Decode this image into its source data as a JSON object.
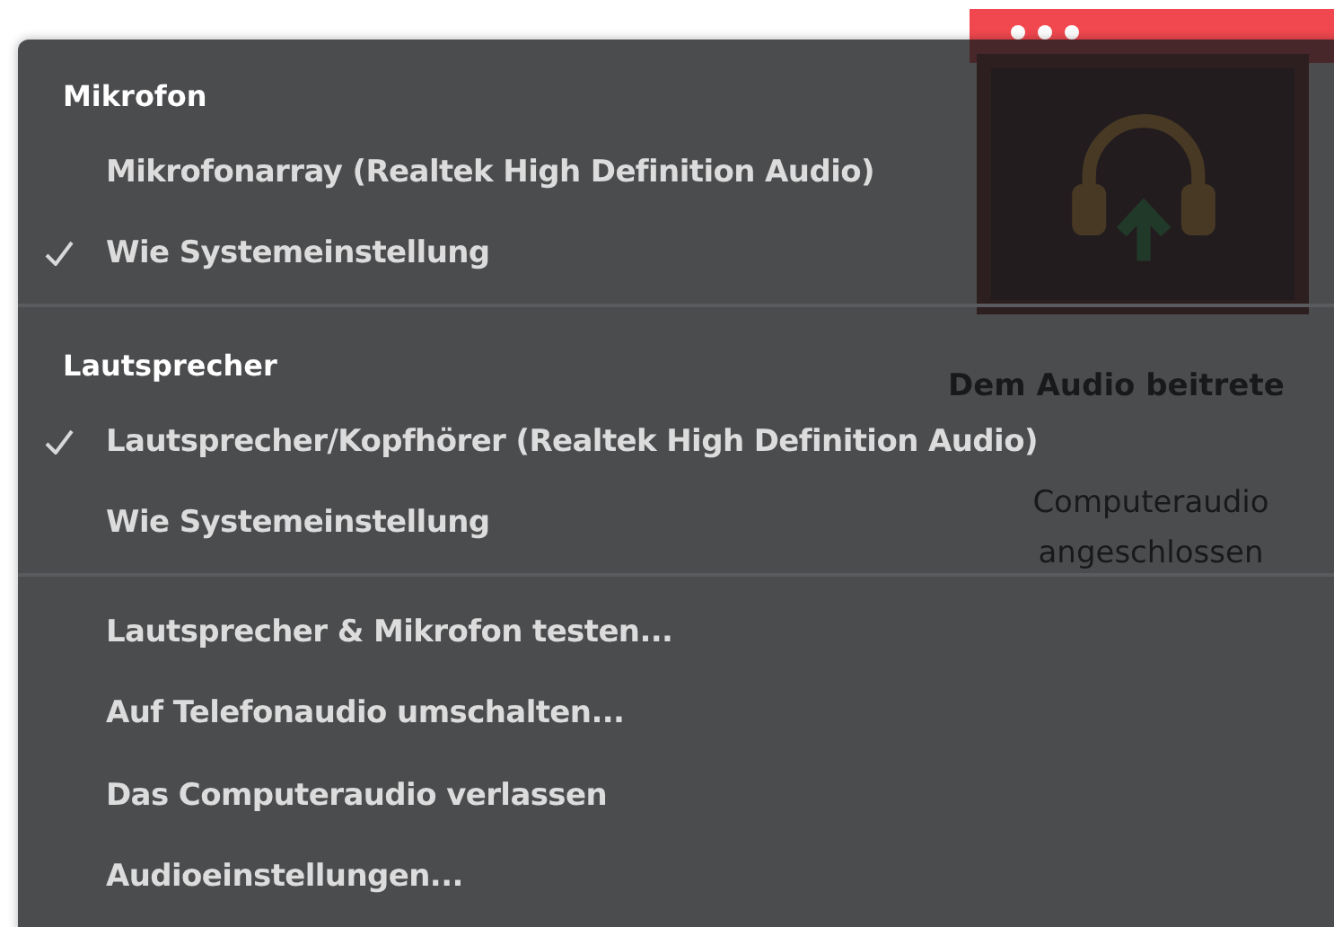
{
  "background": {
    "join_label": "Dem Audio beitrete",
    "status": "Computeraudio angeschlossen"
  },
  "menu": {
    "sections": [
      {
        "header": "Mikrofon",
        "items": [
          {
            "label": "Mikrofonarray (Realtek High Definition Audio)",
            "checked": false
          },
          {
            "label": "Wie Systemeinstellung",
            "checked": true
          }
        ]
      },
      {
        "header": "Lautsprecher",
        "items": [
          {
            "label": "Lautsprecher/Kopfhörer (Realtek High Definition Audio)",
            "checked": true
          },
          {
            "label": "Wie Systemeinstellung",
            "checked": false
          }
        ]
      }
    ],
    "actions": [
      "Lautsprecher & Mikrofon testen...",
      "Auf Telefonaudio umschalten...",
      "Das Computeraudio verlassen",
      "Audioeinstellungen..."
    ]
  }
}
